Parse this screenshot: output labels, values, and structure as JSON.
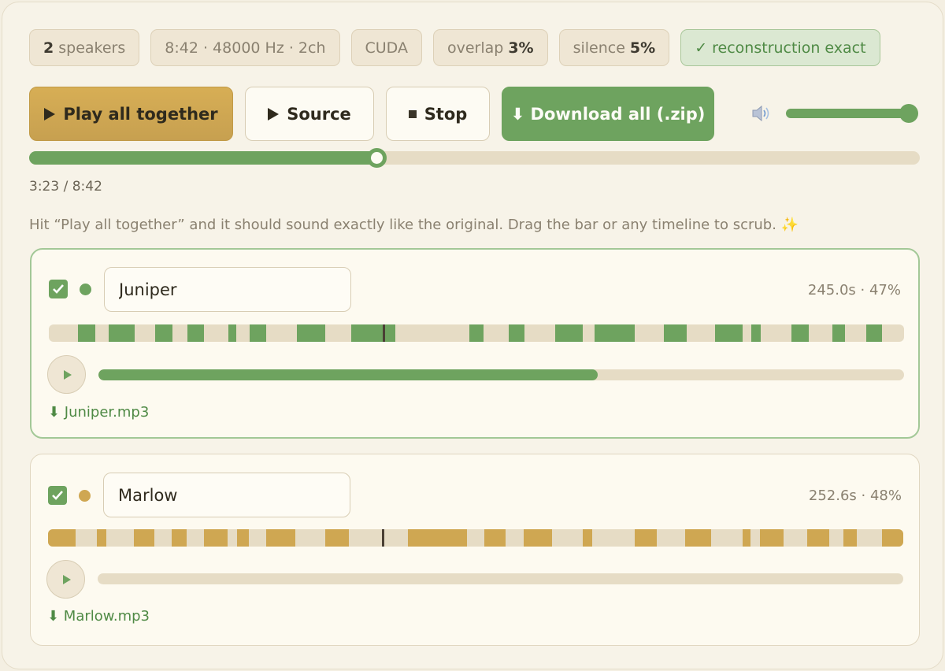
{
  "chips": [
    {
      "bold": "2",
      "text": "speakers",
      "bold_first": true
    },
    {
      "text": "8:42 · 48000 Hz · 2ch"
    },
    {
      "text": "CUDA"
    },
    {
      "text": "overlap",
      "bold": "3%"
    },
    {
      "text": "silence",
      "bold": "5%"
    },
    {
      "text": "✓ reconstruction exact",
      "ok": true
    }
  ],
  "controls": {
    "play_all": "Play all together",
    "source": "Source",
    "stop": "Stop",
    "download_all": "⬇ Download all (.zip)",
    "volume": 1.0
  },
  "playback": {
    "progress": 0.3902,
    "time_label": "3:23 / 8:42"
  },
  "hint": "Hit “Play all together” and it should sound exactly like the original. Drag the bar or any timeline to scrub. ✨",
  "colors": {
    "accent_green": "#6ea35f",
    "accent_gold": "#cfa752",
    "track": "#e6dcc5"
  },
  "speakers": [
    {
      "name": "Juniper",
      "checked": true,
      "color": "#6ea35f",
      "stats": "245.0s · 47%",
      "download": "⬇ Juniper.mp3",
      "progress": 0.62,
      "active": true,
      "segments": [
        [
          0.034,
          0.054
        ],
        [
          0.07,
          0.1
        ],
        [
          0.124,
          0.145
        ],
        [
          0.162,
          0.181
        ],
        [
          0.21,
          0.219
        ],
        [
          0.235,
          0.254
        ],
        [
          0.29,
          0.323
        ],
        [
          0.354,
          0.405
        ],
        [
          0.492,
          0.508
        ],
        [
          0.538,
          0.556
        ],
        [
          0.592,
          0.624
        ],
        [
          0.638,
          0.685
        ],
        [
          0.719,
          0.746
        ],
        [
          0.779,
          0.811
        ],
        [
          0.821,
          0.832
        ],
        [
          0.868,
          0.889
        ],
        [
          0.916,
          0.931
        ],
        [
          0.956,
          0.974
        ]
      ]
    },
    {
      "name": "Marlow",
      "checked": true,
      "color": "#cfa752",
      "stats": "252.6s · 48%",
      "download": "⬇ Marlow.mp3",
      "progress": 0.0,
      "active": false,
      "segments": [
        [
          0.0,
          0.032
        ],
        [
          0.057,
          0.068
        ],
        [
          0.1,
          0.124
        ],
        [
          0.145,
          0.162
        ],
        [
          0.182,
          0.21
        ],
        [
          0.221,
          0.235
        ],
        [
          0.255,
          0.289
        ],
        [
          0.324,
          0.352
        ],
        [
          0.421,
          0.49
        ],
        [
          0.51,
          0.535
        ],
        [
          0.556,
          0.589
        ],
        [
          0.625,
          0.636
        ],
        [
          0.686,
          0.712
        ],
        [
          0.745,
          0.775
        ],
        [
          0.812,
          0.821
        ],
        [
          0.832,
          0.86
        ],
        [
          0.888,
          0.913
        ],
        [
          0.93,
          0.946
        ],
        [
          0.975,
          1.0
        ]
      ]
    }
  ]
}
